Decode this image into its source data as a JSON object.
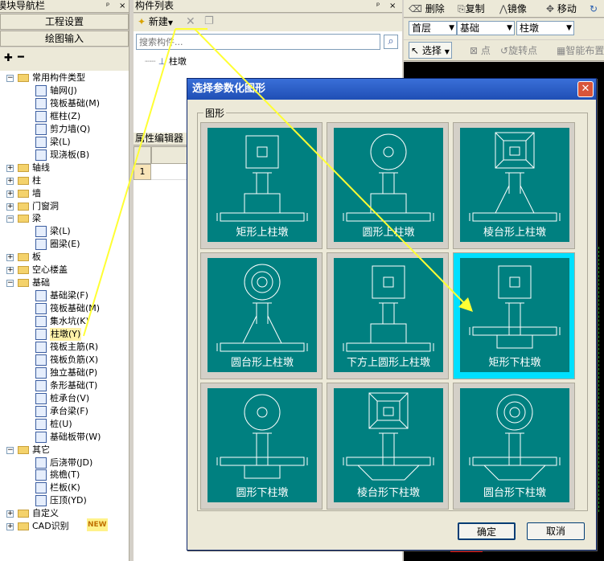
{
  "nav_panel": {
    "title": "模块导航栏",
    "pin": "ᵖ",
    "close": "×",
    "buttons": [
      "工程设置",
      "绘图输入"
    ],
    "tree": [
      {
        "label": "常用构件类型",
        "level": 0,
        "expanded": true,
        "folder": true
      },
      {
        "label": "轴网(J)",
        "level": 1
      },
      {
        "label": "筏板基础(M)",
        "level": 1
      },
      {
        "label": "框柱(Z)",
        "level": 1
      },
      {
        "label": "剪力墙(Q)",
        "level": 1
      },
      {
        "label": "梁(L)",
        "level": 1
      },
      {
        "label": "现浇板(B)",
        "level": 1
      },
      {
        "label": "轴线",
        "level": 0,
        "expanded": false,
        "folder": true
      },
      {
        "label": "柱",
        "level": 0,
        "expanded": false,
        "folder": true
      },
      {
        "label": "墙",
        "level": 0,
        "expanded": false,
        "folder": true
      },
      {
        "label": "门窗洞",
        "level": 0,
        "expanded": false,
        "folder": true
      },
      {
        "label": "梁",
        "level": 0,
        "expanded": true,
        "folder": true
      },
      {
        "label": "梁(L)",
        "level": 1
      },
      {
        "label": "圈梁(E)",
        "level": 1
      },
      {
        "label": "板",
        "level": 0,
        "expanded": false,
        "folder": true
      },
      {
        "label": "空心楼盖",
        "level": 0,
        "expanded": false,
        "folder": true
      },
      {
        "label": "基础",
        "level": 0,
        "expanded": true,
        "folder": true
      },
      {
        "label": "基础梁(F)",
        "level": 1
      },
      {
        "label": "筏板基础(M)",
        "level": 1
      },
      {
        "label": "集水坑(K)",
        "level": 1
      },
      {
        "label": "柱墩(Y)",
        "level": 1,
        "selected": true
      },
      {
        "label": "筏板主筋(R)",
        "level": 1
      },
      {
        "label": "筏板负筋(X)",
        "level": 1
      },
      {
        "label": "独立基础(P)",
        "level": 1
      },
      {
        "label": "条形基础(T)",
        "level": 1
      },
      {
        "label": "桩承台(V)",
        "level": 1
      },
      {
        "label": "承台梁(F)",
        "level": 1
      },
      {
        "label": "桩(U)",
        "level": 1
      },
      {
        "label": "基础板带(W)",
        "level": 1
      },
      {
        "label": "其它",
        "level": 0,
        "expanded": true,
        "folder": true
      },
      {
        "label": "后浇带(JD)",
        "level": 1
      },
      {
        "label": "挑檐(T)",
        "level": 1
      },
      {
        "label": "栏板(K)",
        "level": 1
      },
      {
        "label": "压顶(YD)",
        "level": 1
      },
      {
        "label": "自定义",
        "level": 0,
        "expanded": false,
        "folder": true
      },
      {
        "label": "CAD识别",
        "level": 0,
        "expanded": false,
        "folder": true,
        "badge": "NEW"
      }
    ]
  },
  "component_panel": {
    "title": "构件列表",
    "new_label": "新建",
    "search_placeholder": "搜索构件...",
    "items": [
      "柱墩"
    ]
  },
  "property_panel": {
    "title": "属性编辑器",
    "header": "属",
    "row_number": "1"
  },
  "toolbar": {
    "delete": "删除",
    "copy": "复制",
    "mirror": "镜像",
    "move": "移动",
    "floor": "首层",
    "category": "基础",
    "type": "柱墩",
    "select": "选择",
    "point": "点",
    "rotate_point": "旋转点",
    "smart_layout": "智能布置"
  },
  "dialog": {
    "title": "选择参数化图形",
    "group_label": "图形",
    "shapes": [
      {
        "label": "矩形上柱墩",
        "top": "rect",
        "base": "up-rect"
      },
      {
        "label": "圆形上柱墩",
        "top": "circle",
        "base": "up-rect"
      },
      {
        "label": "棱台形上柱墩",
        "top": "frustum",
        "base": "up-frustum"
      },
      {
        "label": "圆台形上柱墩",
        "top": "double-circle",
        "base": "up-frustum"
      },
      {
        "label": "下方上圆形上柱墩",
        "top": "rect",
        "base": "up-rect"
      },
      {
        "label": "矩形下柱墩",
        "top": "rect",
        "base": "down-rect",
        "selected": true
      },
      {
        "label": "圆形下柱墩",
        "top": "circle",
        "base": "down-rect"
      },
      {
        "label": "棱台形下柱墩",
        "top": "frustum",
        "base": "down-frustum"
      },
      {
        "label": "圆台形下柱墩",
        "top": "double-circle",
        "base": "down-frustum"
      }
    ],
    "ok": "确定",
    "cancel": "取消"
  },
  "colors": {
    "tile": "#008080",
    "selected_border": "#00e0ff",
    "arrow": "#ffff33",
    "canvas": "#000000"
  }
}
